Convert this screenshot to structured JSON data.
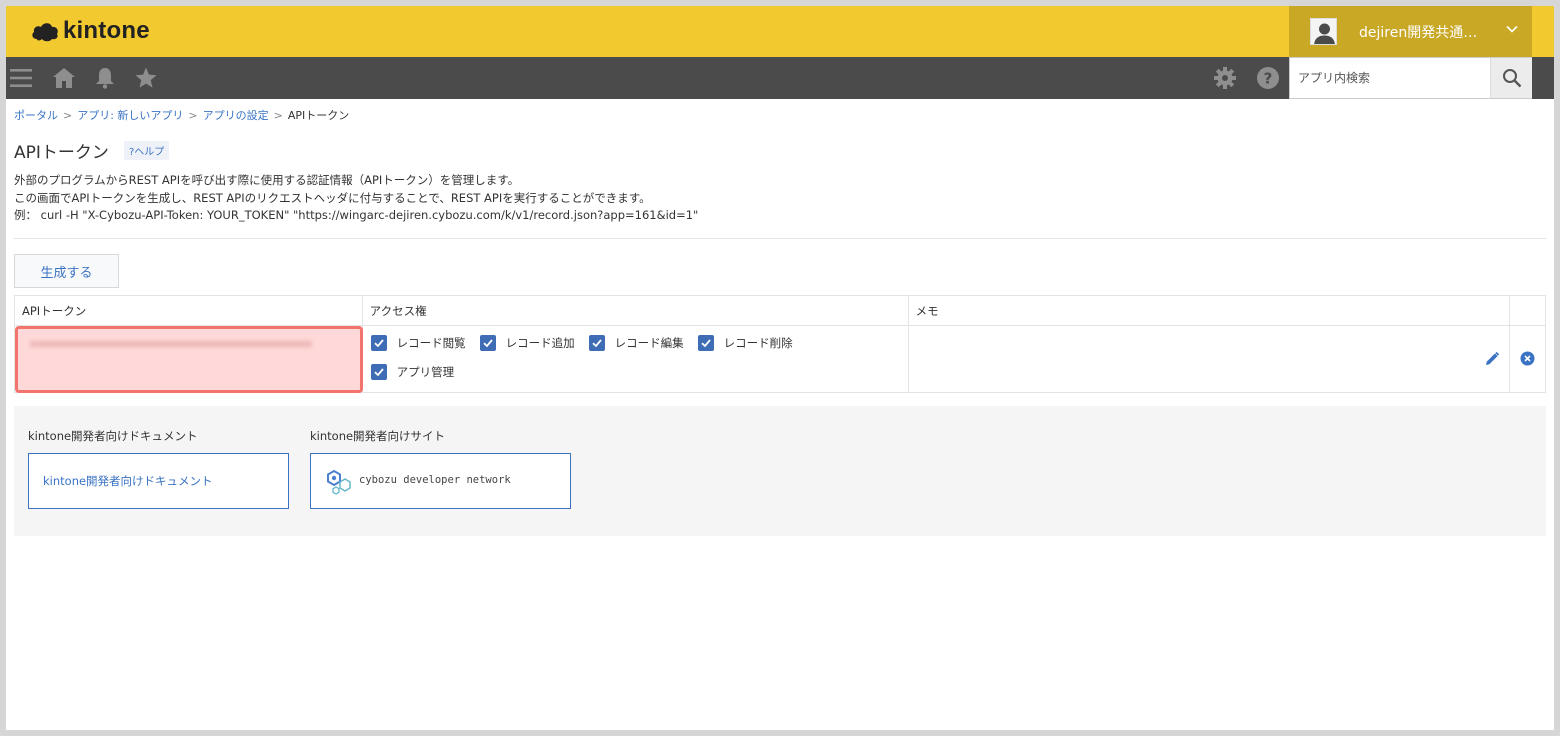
{
  "header": {
    "logo_text": "kintone",
    "user_name": "dejiren開発共通…",
    "colors": {
      "topbar": "#f2c92f",
      "navbar": "#4b4b4b",
      "accent": "#3a73c4"
    }
  },
  "navbar": {
    "icons": [
      "menu-icon",
      "home-icon",
      "bell-icon",
      "star-icon",
      "gear-icon",
      "help-icon"
    ],
    "search_placeholder": "アプリ内検索"
  },
  "breadcrumb": {
    "items": [
      "ポータル",
      "アプリ: 新しいアプリ",
      "アプリの設定"
    ],
    "current": "APIトークン",
    "separator": ">"
  },
  "page": {
    "title": "APIトークン",
    "help_label": "?ヘルプ",
    "desc_lines": [
      "外部のプログラムからREST APIを呼び出す際に使用する認証情報（APIトークン）を管理します。",
      "この画面でAPIトークンを生成し、REST APIのリクエストヘッダに付与することで、REST APIを実行することができます。",
      "例： curl -H \"X-Cybozu-API-Token: YOUR_TOKEN\" \"https://wingarc-dejiren.cybozu.com/k/v1/record.json?app=161&id=1\""
    ],
    "generate_label": "生成する"
  },
  "table": {
    "headers": [
      "APIトークン",
      "アクセス権",
      "メモ"
    ],
    "row": {
      "permissions": [
        {
          "label": "レコード閲覧",
          "checked": true
        },
        {
          "label": "レコード追加",
          "checked": true
        },
        {
          "label": "レコード編集",
          "checked": true
        },
        {
          "label": "レコード削除",
          "checked": true
        },
        {
          "label": "アプリ管理",
          "checked": true
        }
      ],
      "memo": ""
    }
  },
  "docs": {
    "doc_heading": "kintone開発者向けドキュメント",
    "doc_link": "kintone開発者向けドキュメント",
    "site_heading": "kintone開発者向けサイト",
    "site_link": "cybozu developer network"
  }
}
